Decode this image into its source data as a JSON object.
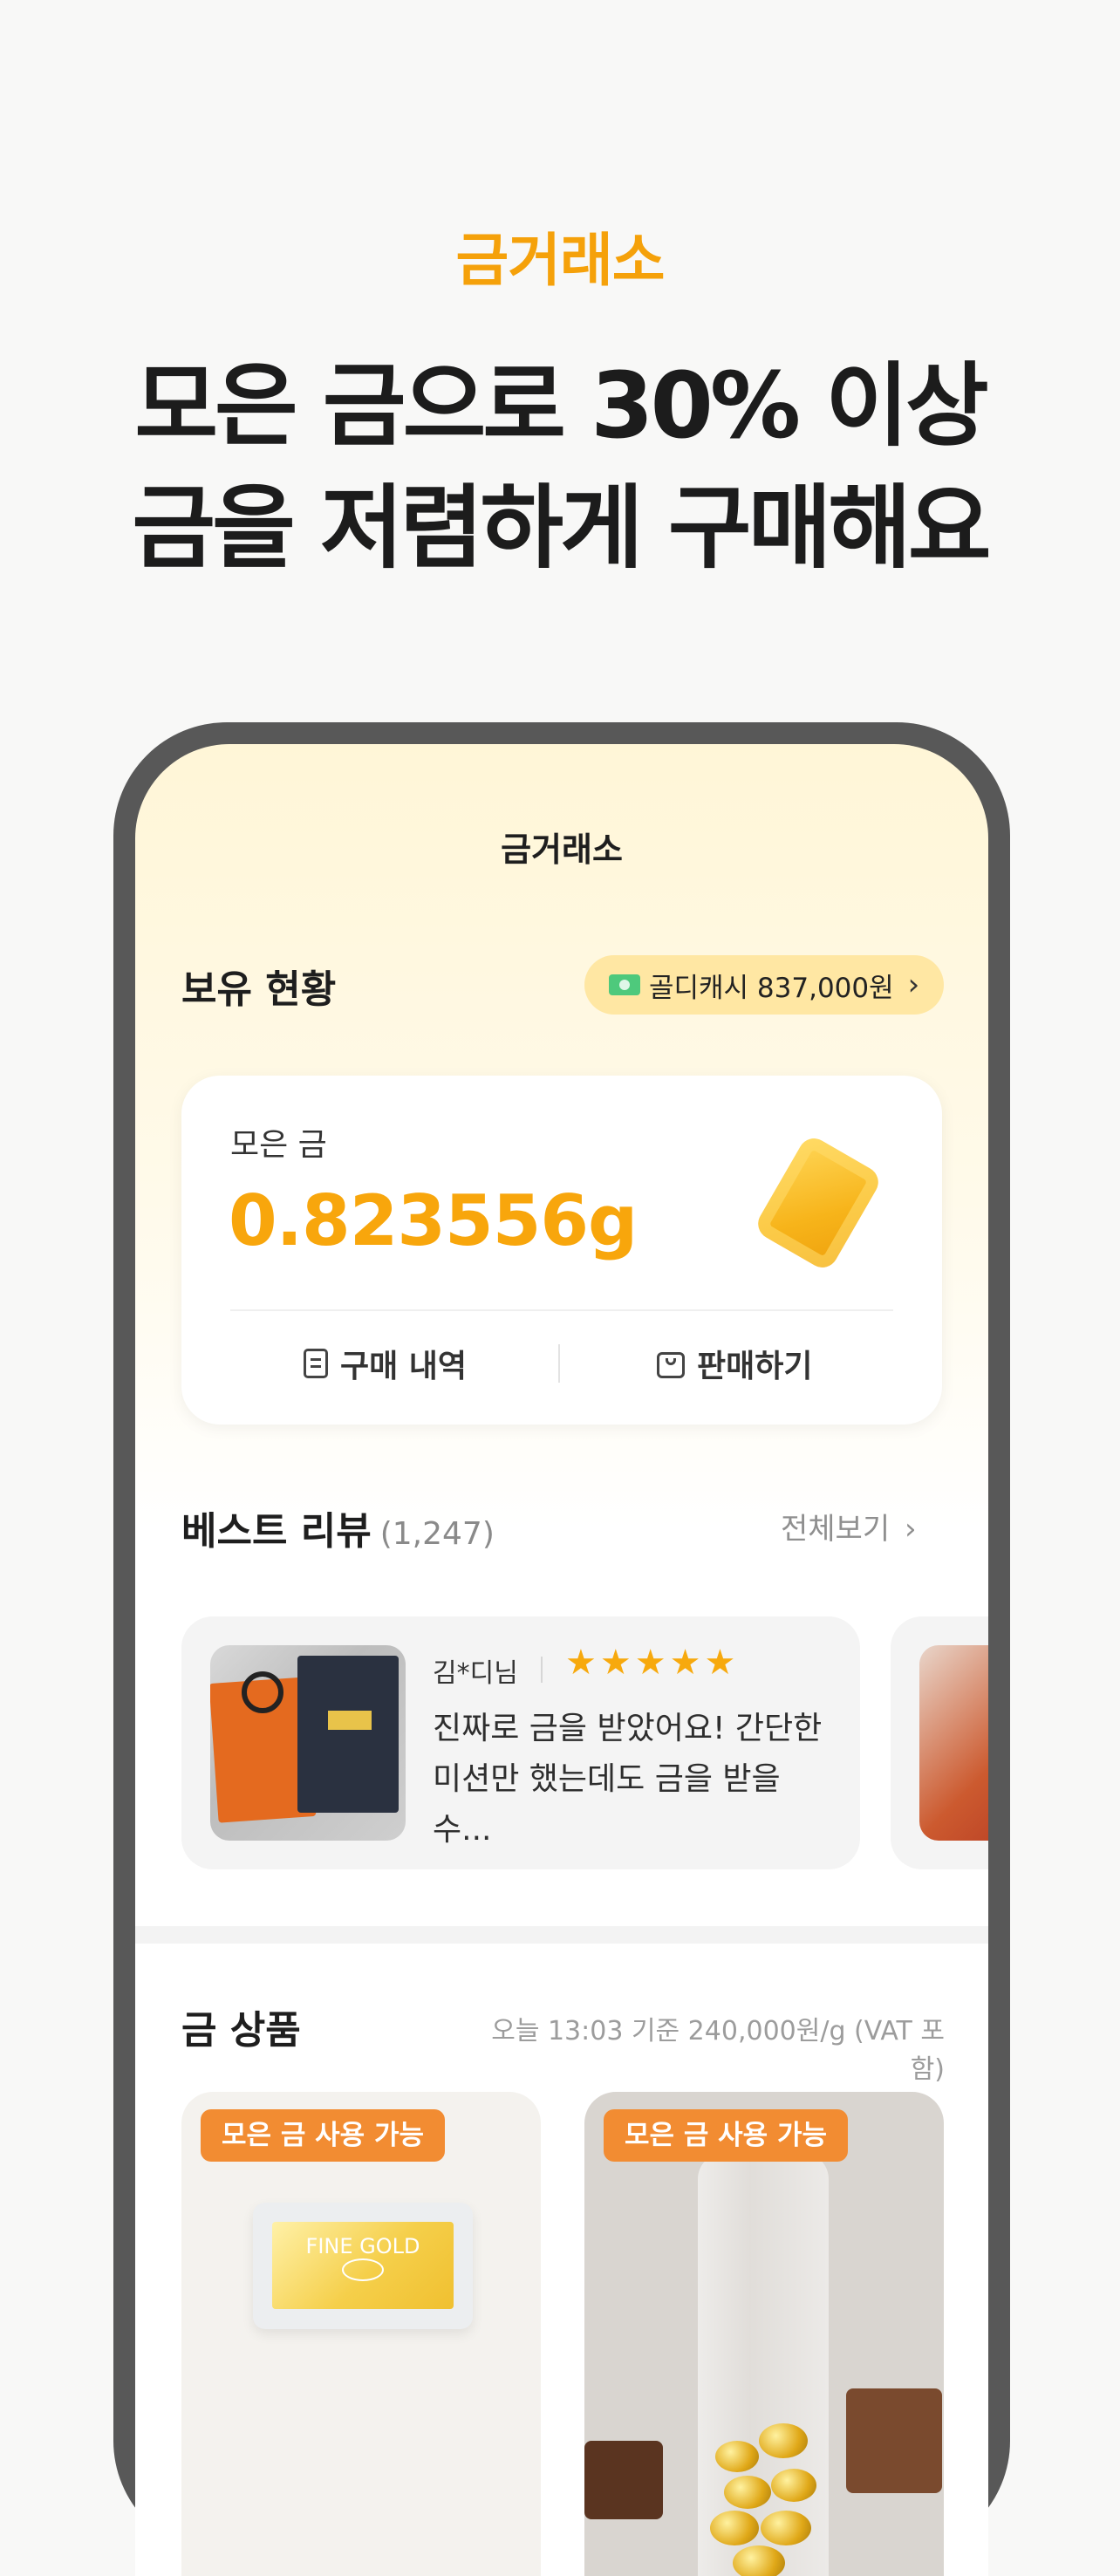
{
  "hero": {
    "eyebrow": "금거래소",
    "title_line1": "모은 금으로 30% 이상",
    "title_line2": "금을 저렴하게 구매해요"
  },
  "screen": {
    "title": "금거래소"
  },
  "holdings": {
    "section_title": "보유 현황",
    "cash_label": "골디캐시 837,000원",
    "card_label": "모은 금",
    "card_value": "0.823556g",
    "buy_history_label": "구매 내역",
    "sell_label": "판매하기"
  },
  "best_reviews": {
    "section_title": "베스트 리뷰",
    "count": "(1,247)",
    "see_all": "전체보기",
    "items": [
      {
        "reviewer": "김*디님",
        "rating": 5,
        "stars": "★★★★★",
        "text": "진짜로 금을 받았어요! 간단한 미션만 했는데도 금을 받을 수..."
      }
    ]
  },
  "products": {
    "section_title": "금 상품",
    "price_note": "오늘 13:03 기준 240,000원/g (VAT 포함)",
    "items": [
      {
        "badge": "모은 금 사용 가능",
        "image_text": "FINE GOLD"
      },
      {
        "badge": "모은 금 사용 가능"
      }
    ]
  },
  "colors": {
    "accent": "#f5a10a",
    "badge": "#f28c32",
    "pill": "#ffe7a3"
  },
  "icons": [
    "cash-icon",
    "chevron-right-icon",
    "receipt-icon",
    "shopping-bag-icon",
    "star-icon",
    "gold-bar-icon"
  ]
}
